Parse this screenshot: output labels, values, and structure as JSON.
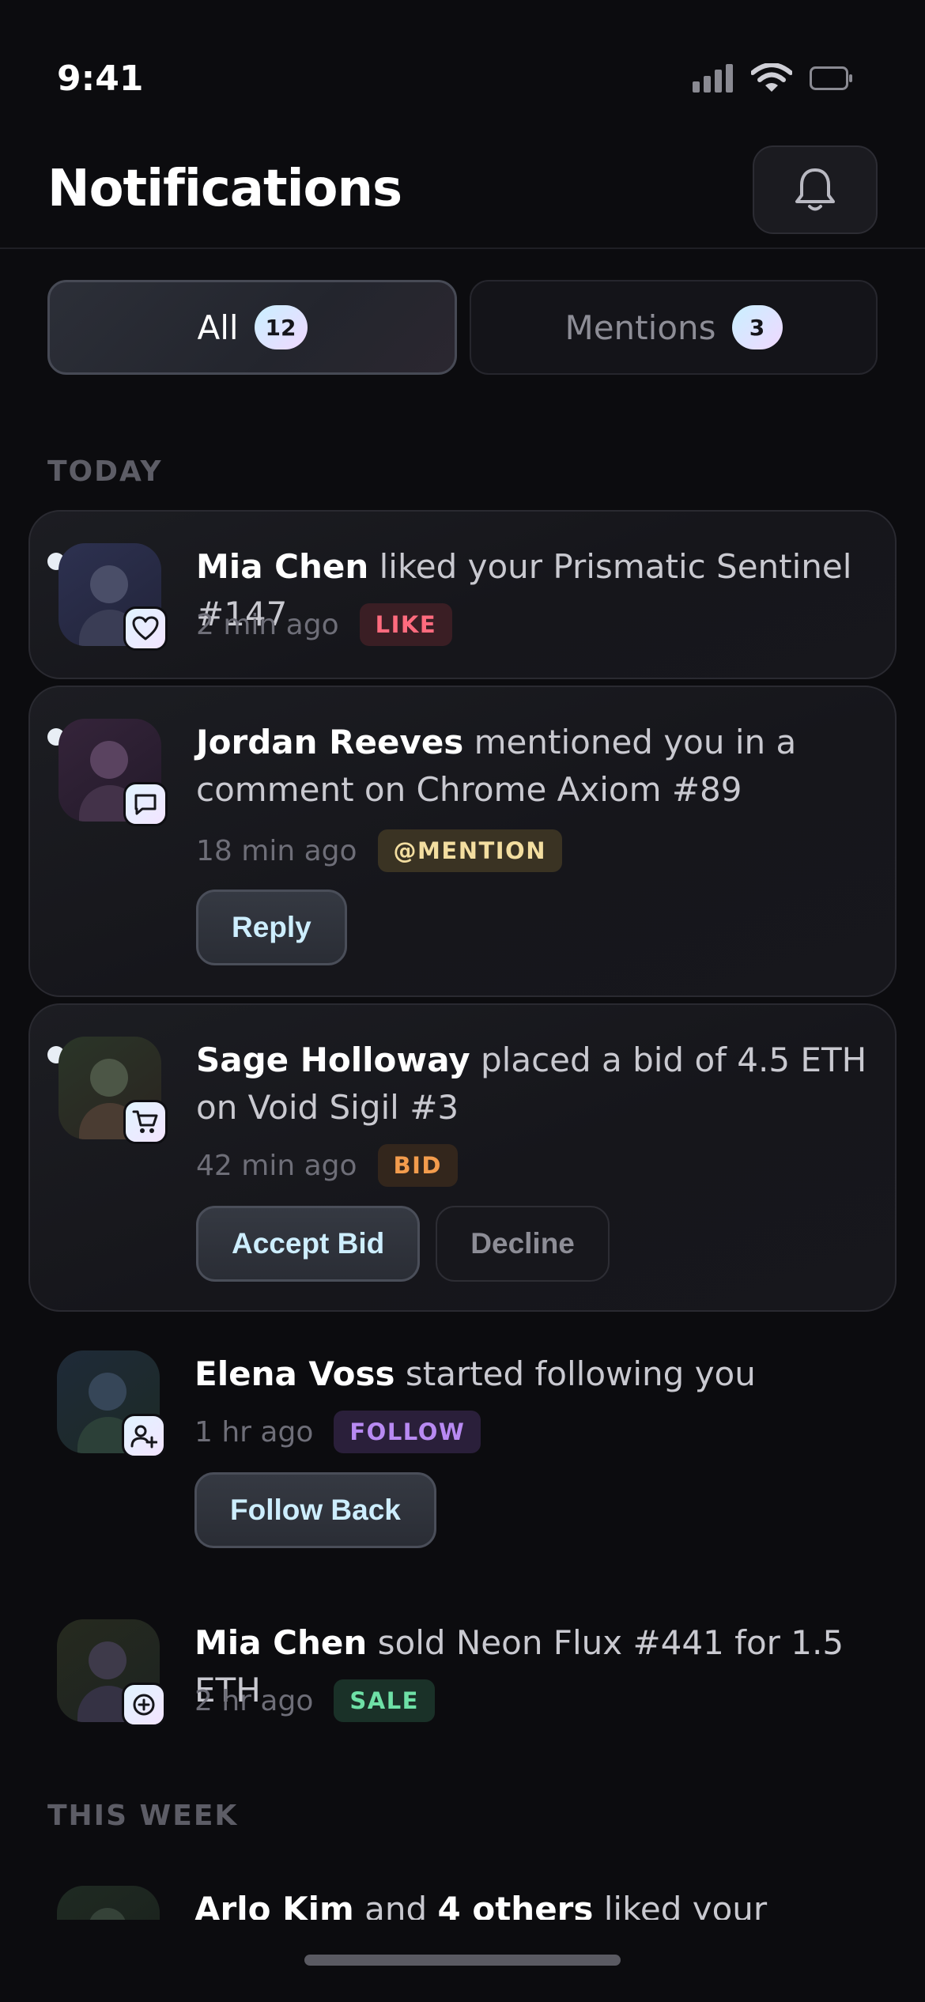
{
  "status_bar": {
    "time": "9:41"
  },
  "header": {
    "title": "Notifications"
  },
  "tabs": [
    {
      "label": "All",
      "count": "12",
      "active": true
    },
    {
      "label": "Mentions",
      "count": "3",
      "active": false
    }
  ],
  "sections": {
    "today": "TODAY",
    "this_week": "THIS WEEK"
  },
  "notifications": [
    {
      "actor": "Mia Chen",
      "text": " liked your Prismatic Sentinel #147",
      "time": "2 min ago",
      "tag": "LIKE",
      "icon": "heart-icon",
      "unread": true
    },
    {
      "actor": "Jordan Reeves",
      "text": " mentioned you in a comment on Chrome Axiom #89",
      "time": "18 min ago",
      "tag": "@MENTION",
      "icon": "comment-icon",
      "unread": true,
      "actions": [
        "Reply"
      ]
    },
    {
      "actor": "Sage Holloway",
      "text": " placed a bid of 4.5 ETH on Void Sigil #3",
      "time": "42 min ago",
      "tag": "BID",
      "icon": "cart-icon",
      "unread": true,
      "actions": [
        "Accept Bid",
        "Decline"
      ]
    },
    {
      "actor": "Elena Voss",
      "text": " started following you",
      "time": "1 hr ago",
      "tag": "FOLLOW",
      "icon": "user-plus-icon",
      "unread": false,
      "actions": [
        "Follow Back"
      ]
    },
    {
      "actor": "Mia Chen",
      "text": " sold Neon Flux #441 for 1.5 ETH",
      "time": "2 hr ago",
      "tag": "SALE",
      "icon": "plus-circle-icon",
      "unread": false
    },
    {
      "actor": "Arlo Kim",
      "connector": " and ",
      "others": "4 others",
      "text": " liked your Lumina",
      "icon": "heart-icon",
      "unread": false
    }
  ],
  "colors": {
    "background": "#0c0c0f",
    "like": "#ff6b7e",
    "mention": "#f3dea0",
    "bid": "#f39c4d",
    "follow": "#b88af2",
    "sale": "#6ee0a6"
  }
}
